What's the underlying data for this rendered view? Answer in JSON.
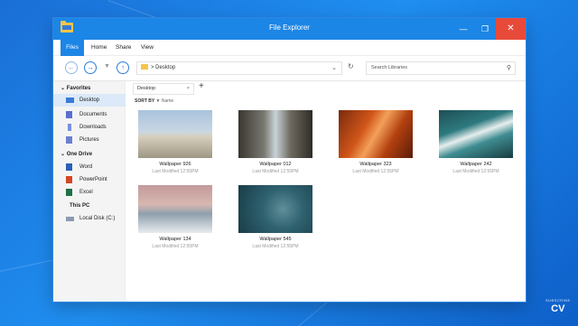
{
  "window": {
    "title": "File Explorer"
  },
  "menu": {
    "files": "Files",
    "home": "Home",
    "share": "Share",
    "view": "View"
  },
  "address": {
    "path": "> Desktop"
  },
  "search": {
    "placeholder": "Search Libraries"
  },
  "sidebar": {
    "favorites_header": "Favorites",
    "favorites": [
      {
        "label": "Desktop",
        "icon": "desktop-icon"
      },
      {
        "label": "Documents",
        "icon": "documents-icon"
      },
      {
        "label": "Downloads",
        "icon": "downloads-icon"
      },
      {
        "label": "Pictures",
        "icon": "pictures-icon"
      }
    ],
    "onedrive_header": "One Drive",
    "onedrive": [
      {
        "label": "Word",
        "icon": "word-icon"
      },
      {
        "label": "PowerPoint",
        "icon": "powerpoint-icon"
      },
      {
        "label": "Excel",
        "icon": "excel-icon"
      }
    ],
    "thispc_header": "This PC",
    "thispc": [
      {
        "label": "Local Disk (C:)",
        "icon": "disk-icon"
      }
    ]
  },
  "tab": {
    "label": "Desktop"
  },
  "sort": {
    "label": "SORT BY",
    "value": "Name"
  },
  "files": [
    {
      "name": "Wallpaper 926",
      "modified": "Last Modified 12:55PM"
    },
    {
      "name": "Wallpaper 012",
      "modified": "Last Modified 12:55PM"
    },
    {
      "name": "Wallpaper 323",
      "modified": "Last Modified 12:55PM"
    },
    {
      "name": "Wallpaper 242",
      "modified": "Last Modified 12:55PM"
    },
    {
      "name": "Wallpaper 134",
      "modified": "Last Modified 12:55PM"
    },
    {
      "name": "Wallpaper 545",
      "modified": "Last Modified 12:55PM"
    }
  ],
  "brand": {
    "subscribe": "SUBSCRIBE",
    "logo": "CV"
  },
  "colors": {
    "accent": "#1c86e6",
    "close": "#e84a3a"
  }
}
